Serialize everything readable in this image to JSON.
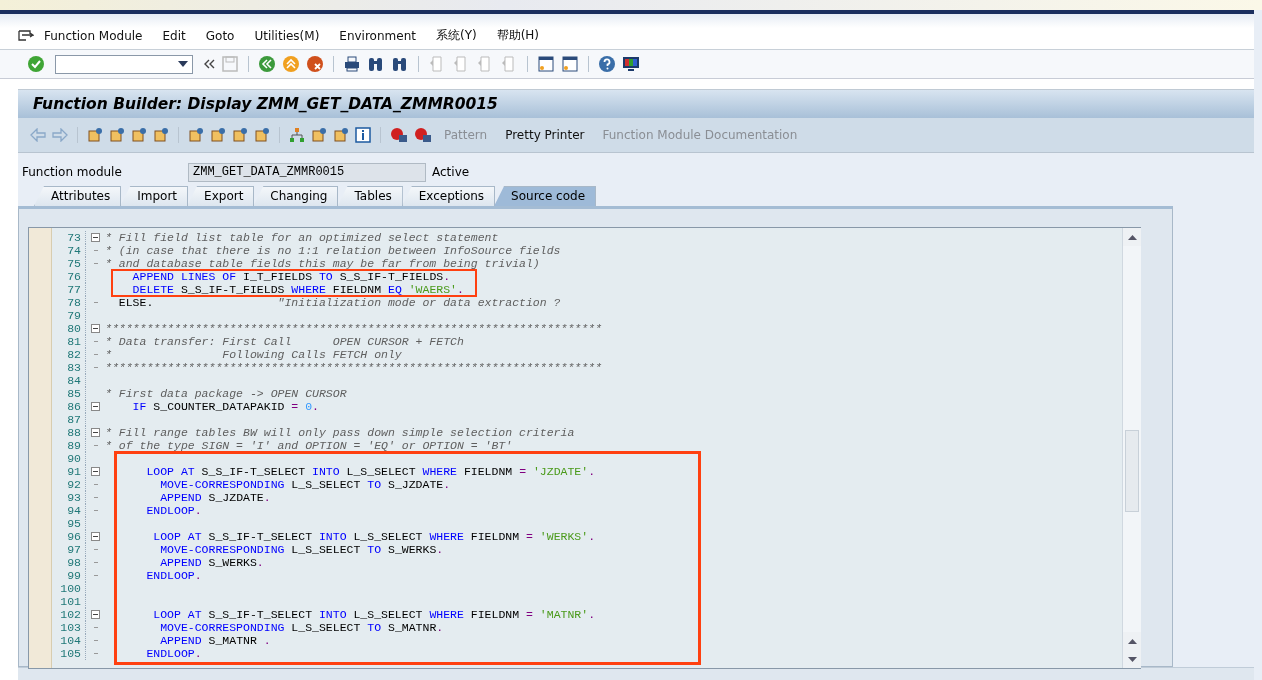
{
  "menu": [
    {
      "label": "Function Module"
    },
    {
      "label": "Edit"
    },
    {
      "label": "Goto"
    },
    {
      "label": "Utilities(M)"
    },
    {
      "label": "Environment"
    },
    {
      "label": "系统(Y)"
    },
    {
      "label": "帮助(H)"
    }
  ],
  "title": "Function Builder: Display ZMM_GET_DATA_ZMMR0015",
  "app_toolbar": [
    {
      "label": "Pattern",
      "disabled": true
    },
    {
      "label": "Pretty Printer",
      "disabled": false
    },
    {
      "label": "Function Module Documentation",
      "disabled": true
    }
  ],
  "function_module": {
    "label": "Function module",
    "value": "ZMM_GET_DATA_ZMMR0015",
    "status": "Active"
  },
  "tabs": [
    {
      "label": "Attributes",
      "selected": false
    },
    {
      "label": "Import",
      "selected": false
    },
    {
      "label": "Export",
      "selected": false
    },
    {
      "label": "Changing",
      "selected": false
    },
    {
      "label": "Tables",
      "selected": false
    },
    {
      "label": "Exceptions",
      "selected": false
    },
    {
      "label": "Source code",
      "selected": true
    }
  ],
  "code": [
    {
      "no": "73",
      "kind": "fold-start",
      "tokens": [
        {
          "kind": "comment",
          "text": "* Fill field list table for an optimized select statement"
        }
      ]
    },
    {
      "no": "74",
      "kind": "fold-inner",
      "tokens": [
        {
          "kind": "comment",
          "text": "* (in case that there is no 1:1 relation between InfoSource fields"
        }
      ]
    },
    {
      "no": "75",
      "kind": "fold-inner",
      "tokens": [
        {
          "kind": "comment",
          "text": "* and database table fields this may be far from being trivial)"
        }
      ]
    },
    {
      "no": "76",
      "kind": "plain",
      "tokens": [
        {
          "kind": "keyword",
          "text": "    APPEND LINES OF"
        },
        {
          "kind": "name",
          "text": " I_T_FIELDS "
        },
        {
          "kind": "keyword",
          "text": "TO"
        },
        {
          "kind": "name",
          "text": " S_S_IF-T_FIELDS"
        },
        {
          "kind": "operator",
          "text": "."
        }
      ]
    },
    {
      "no": "77",
      "kind": "plain",
      "tokens": [
        {
          "kind": "keyword",
          "text": "    DELETE"
        },
        {
          "kind": "name",
          "text": " S_S_IF-T_FIELDS "
        },
        {
          "kind": "keyword",
          "text": "WHERE"
        },
        {
          "kind": "name",
          "text": " FIELDNM "
        },
        {
          "kind": "keyword",
          "text": "EQ"
        },
        {
          "kind": "string",
          "text": " 'WAERS'"
        },
        {
          "kind": "operator",
          "text": "."
        }
      ]
    },
    {
      "no": "78",
      "kind": "fold-inner",
      "tokens": [
        {
          "kind": "name",
          "text": "  ELSE."
        },
        {
          "kind": "comment",
          "text": "                  \"Initialization mode or data extraction ?"
        }
      ]
    },
    {
      "no": "79",
      "kind": "plain"
    },
    {
      "no": "80",
      "kind": "fold-start",
      "tokens": [
        {
          "kind": "comment",
          "text": "************************************************************************"
        }
      ]
    },
    {
      "no": "81",
      "kind": "fold-inner",
      "tokens": [
        {
          "kind": "comment",
          "text": "* Data transfer: First Call      OPEN CURSOR + FETCh"
        }
      ]
    },
    {
      "no": "82",
      "kind": "fold-inner",
      "tokens": [
        {
          "kind": "comment",
          "text": "*                Following Calls FETCH only"
        }
      ]
    },
    {
      "no": "83",
      "kind": "fold-inner",
      "tokens": [
        {
          "kind": "comment",
          "text": "************************************************************************"
        }
      ]
    },
    {
      "no": "84",
      "kind": "plain"
    },
    {
      "no": "85",
      "kind": "plain",
      "tokens": [
        {
          "kind": "comment",
          "text": "* First data package -> OPEN CURSOR"
        }
      ]
    },
    {
      "no": "86",
      "kind": "fold-start",
      "tokens": [
        {
          "kind": "keyword",
          "text": "    IF"
        },
        {
          "kind": "name",
          "text": " S_COUNTER_DATAPAKID "
        },
        {
          "kind": "operator",
          "text": "="
        },
        {
          "kind": "number",
          "text": " 0"
        },
        {
          "kind": "operator",
          "text": "."
        }
      ]
    },
    {
      "no": "87",
      "kind": "plain"
    },
    {
      "no": "88",
      "kind": "fold-start",
      "tokens": [
        {
          "kind": "comment",
          "text": "* Fill range tables BW will only pass down simple selection criteria"
        }
      ]
    },
    {
      "no": "89",
      "kind": "fold-inner",
      "tokens": [
        {
          "kind": "comment",
          "text": "* of the type SIGN = 'I' and OPTION = 'EQ' or OPTION = 'BT'"
        }
      ]
    },
    {
      "no": "90",
      "kind": "plain"
    },
    {
      "no": "91",
      "kind": "fold-start",
      "tokens": [
        {
          "kind": "keyword",
          "text": "      LOOP AT"
        },
        {
          "kind": "name",
          "text": " S_S_IF-T_SELECT "
        },
        {
          "kind": "keyword",
          "text": "INTO"
        },
        {
          "kind": "name",
          "text": " L_S_SELECT "
        },
        {
          "kind": "keyword",
          "text": "WHERE"
        },
        {
          "kind": "name",
          "text": " FIELDNM "
        },
        {
          "kind": "operator",
          "text": "="
        },
        {
          "kind": "string",
          "text": " 'JZDATE'"
        },
        {
          "kind": "operator",
          "text": "."
        }
      ]
    },
    {
      "no": "92",
      "kind": "fold-inner",
      "tokens": [
        {
          "kind": "keyword",
          "text": "        MOVE-CORRESPONDING"
        },
        {
          "kind": "name",
          "text": " L_S_SELECT "
        },
        {
          "kind": "keyword",
          "text": "TO"
        },
        {
          "kind": "name",
          "text": " S_JZDATE"
        },
        {
          "kind": "operator",
          "text": "."
        }
      ]
    },
    {
      "no": "93",
      "kind": "fold-inner",
      "tokens": [
        {
          "kind": "keyword",
          "text": "        APPEND"
        },
        {
          "kind": "name",
          "text": " S_JZDATE"
        },
        {
          "kind": "operator",
          "text": "."
        }
      ]
    },
    {
      "no": "94",
      "kind": "fold-inner",
      "tokens": [
        {
          "kind": "keyword",
          "text": "      ENDLOOP"
        },
        {
          "kind": "operator",
          "text": "."
        }
      ]
    },
    {
      "no": "95",
      "kind": "plain"
    },
    {
      "no": "96",
      "kind": "fold-start",
      "tokens": [
        {
          "kind": "keyword",
          "text": "       LOOP AT"
        },
        {
          "kind": "name",
          "text": " S_S_IF-T_SELECT "
        },
        {
          "kind": "keyword",
          "text": "INTO"
        },
        {
          "kind": "name",
          "text": " L_S_SELECT "
        },
        {
          "kind": "keyword",
          "text": "WHERE"
        },
        {
          "kind": "name",
          "text": " FIELDNM "
        },
        {
          "kind": "operator",
          "text": "="
        },
        {
          "kind": "string",
          "text": " 'WERKS'"
        },
        {
          "kind": "operator",
          "text": "."
        }
      ]
    },
    {
      "no": "97",
      "kind": "fold-inner",
      "tokens": [
        {
          "kind": "keyword",
          "text": "        MOVE-CORRESPONDING"
        },
        {
          "kind": "name",
          "text": " L_S_SELECT "
        },
        {
          "kind": "keyword",
          "text": "TO"
        },
        {
          "kind": "name",
          "text": " S_WERKS"
        },
        {
          "kind": "operator",
          "text": "."
        }
      ]
    },
    {
      "no": "98",
      "kind": "fold-inner",
      "tokens": [
        {
          "kind": "keyword",
          "text": "        APPEND"
        },
        {
          "kind": "name",
          "text": " S_WERKS"
        },
        {
          "kind": "operator",
          "text": "."
        }
      ]
    },
    {
      "no": "99",
      "kind": "fold-inner",
      "tokens": [
        {
          "kind": "keyword",
          "text": "      ENDLOOP"
        },
        {
          "kind": "operator",
          "text": "."
        }
      ]
    },
    {
      "no": "100",
      "kind": "plain"
    },
    {
      "no": "101",
      "kind": "plain"
    },
    {
      "no": "102",
      "kind": "fold-start",
      "tokens": [
        {
          "kind": "keyword",
          "text": "       LOOP AT"
        },
        {
          "kind": "name",
          "text": " S_S_IF-T_SELECT "
        },
        {
          "kind": "keyword",
          "text": "INTO"
        },
        {
          "kind": "name",
          "text": " L_S_SELECT "
        },
        {
          "kind": "keyword",
          "text": "WHERE"
        },
        {
          "kind": "name",
          "text": " FIELDNM "
        },
        {
          "kind": "operator",
          "text": "="
        },
        {
          "kind": "string",
          "text": " 'MATNR'"
        },
        {
          "kind": "operator",
          "text": "."
        }
      ]
    },
    {
      "no": "103",
      "kind": "fold-inner",
      "tokens": [
        {
          "kind": "keyword",
          "text": "        MOVE-CORRESPONDING"
        },
        {
          "kind": "name",
          "text": " L_S_SELECT "
        },
        {
          "kind": "keyword",
          "text": "TO"
        },
        {
          "kind": "name",
          "text": " S_MATNR"
        },
        {
          "kind": "operator",
          "text": "."
        }
      ]
    },
    {
      "no": "104",
      "kind": "fold-inner",
      "tokens": [
        {
          "kind": "keyword",
          "text": "        APPEND"
        },
        {
          "kind": "name",
          "text": " S_MATNR "
        },
        {
          "kind": "operator",
          "text": "."
        }
      ]
    },
    {
      "no": "105",
      "kind": "fold-inner",
      "tokens": [
        {
          "kind": "keyword",
          "text": "      ENDLOOP"
        },
        {
          "kind": "operator",
          "text": "."
        }
      ]
    }
  ]
}
